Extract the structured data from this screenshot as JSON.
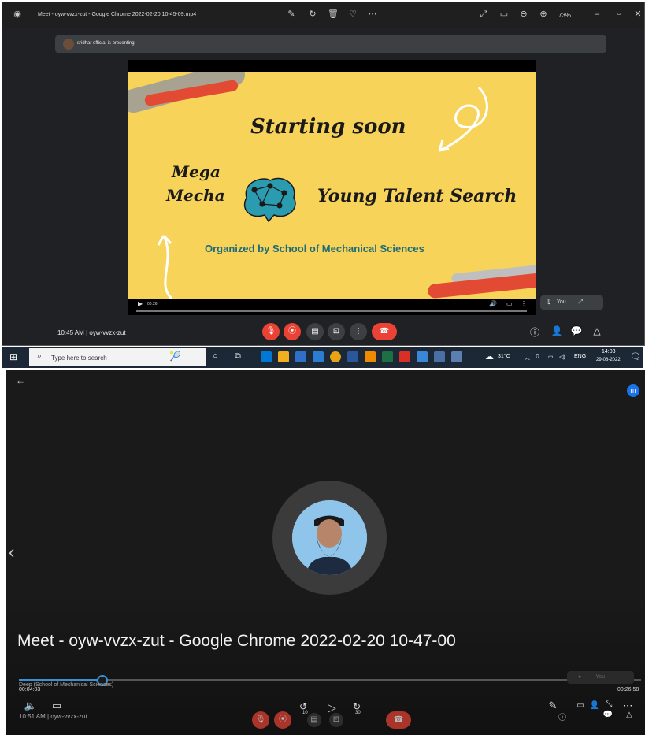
{
  "top_window": {
    "title": "Meet - oyw-vvzx-zut - Google Chrome 2022-02-20 10-45-09.mp4",
    "zoom": "73%",
    "presenting_text": "sridhar official is presenting",
    "slide": {
      "heading": "Starting soon",
      "mega": "Mega",
      "mecha": "Mecha",
      "event": "Young Talent Search",
      "organizer": "Organized by School of Mechanical Sciences",
      "video_time": "00:26"
    },
    "self_tile_label": "You",
    "meet_time": "10:45 AM",
    "meeting_code": "oyw-vvzx-zut",
    "colors": {
      "danger": "#ea4335",
      "slide_bg": "#f7d35a",
      "teal": "#1f6b78"
    }
  },
  "taskbar": {
    "search_placeholder": "Type here to search",
    "temperature": "31°C",
    "language": "ENG",
    "clock_time": "14:03",
    "clock_date": "29-08-2022"
  },
  "bottom_window": {
    "title": "Meet - oyw-vvzx-zut - Google Chrome 2022-02-20 10-47-00",
    "participant_label": "Deep (School of Mechanical Sciences)",
    "elapsed": "00:04:03",
    "duration": "00:26:58",
    "meet_time": "10:51 AM",
    "meeting_code": "oyw-vvzx-zut",
    "self_tile_label": "You",
    "progress_fraction": 0.133,
    "skip_back": "10",
    "skip_forward": "30"
  }
}
